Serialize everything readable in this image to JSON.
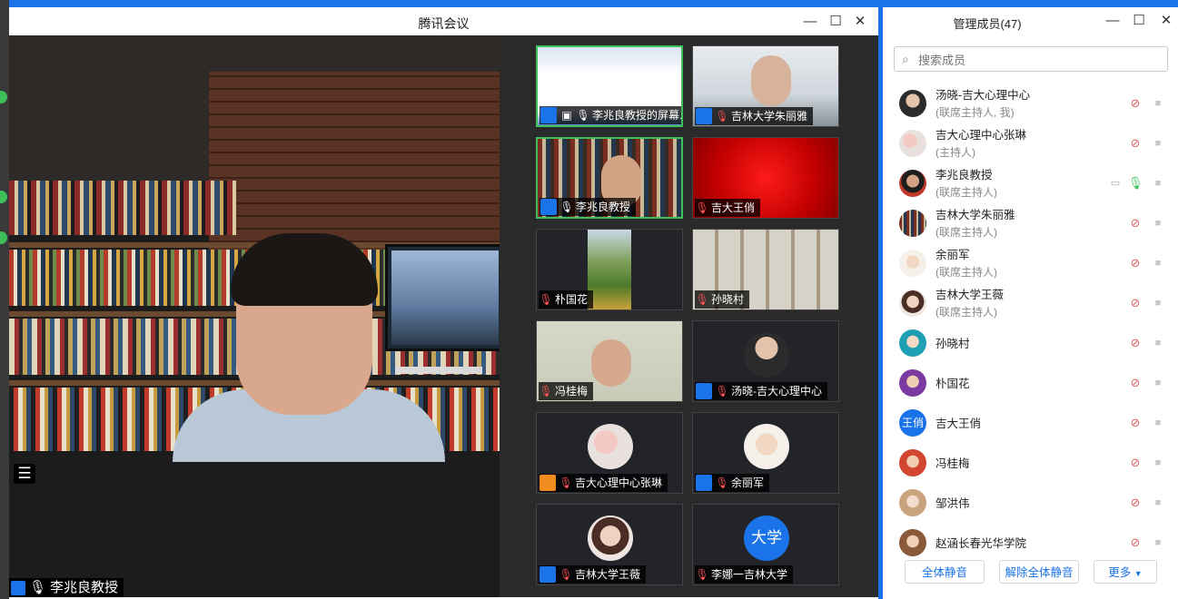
{
  "meeting_window": {
    "title": "腾讯会议",
    "speaker_name": "李兆良教授",
    "tiles": [
      {
        "name": "李兆良教授的屏幕...",
        "type": "screen",
        "mic": "on",
        "active": true
      },
      {
        "name": "吉林大学朱丽雅",
        "type": "video",
        "mic": "muted",
        "active": false
      },
      {
        "name": "李兆良教授",
        "type": "video",
        "mic": "on",
        "active": true
      },
      {
        "name": "吉大王俏",
        "type": "red",
        "mic": "muted",
        "active": false
      },
      {
        "name": "朴国花",
        "type": "landscape",
        "mic": "muted",
        "active": false
      },
      {
        "name": "孙晓村",
        "type": "room",
        "mic": "muted",
        "active": false
      },
      {
        "name": "冯桂梅",
        "type": "video",
        "mic": "muted",
        "active": false
      },
      {
        "name": "汤晓-吉大心理中心",
        "type": "avatar",
        "mic": "muted",
        "active": false
      },
      {
        "name": "吉大心理中心张琳",
        "type": "avatar",
        "mic": "muted",
        "active": false
      },
      {
        "name": "余丽军",
        "type": "avatar",
        "mic": "muted",
        "active": false
      },
      {
        "name": "吉林大学王薇",
        "type": "avatar",
        "mic": "muted",
        "active": false
      },
      {
        "name": "李娜一吉林大学",
        "type": "text-avatar",
        "avatar_text": "大学",
        "mic": "muted",
        "active": false
      }
    ]
  },
  "member_panel": {
    "title": "管理成员(47)",
    "search_placeholder": "搜索成员",
    "members": [
      {
        "name": "汤晓-吉大心理中心",
        "role": "(联席主持人, 我)",
        "mic": "muted"
      },
      {
        "name": "吉大心理中心张琳",
        "role": "(主持人)",
        "mic": "muted"
      },
      {
        "name": "李兆良教授",
        "role": "(联席主持人)",
        "mic": "on",
        "sharing": true
      },
      {
        "name": "吉林大学朱丽雅",
        "role": "(联席主持人)",
        "mic": "muted"
      },
      {
        "name": "余丽军",
        "role": "(联席主持人)",
        "mic": "muted"
      },
      {
        "name": "吉林大学王薇",
        "role": "(联席主持人)",
        "mic": "muted"
      },
      {
        "name": "孙晓村",
        "role": "",
        "mic": "muted"
      },
      {
        "name": "朴国花",
        "role": "",
        "mic": "muted"
      },
      {
        "name": "吉大王俏",
        "role": "",
        "mic": "muted",
        "avatar_text": "王俏"
      },
      {
        "name": "冯桂梅",
        "role": "",
        "mic": "muted"
      },
      {
        "name": "邹洪伟",
        "role": "",
        "mic": "muted"
      },
      {
        "name": "赵涵长春光华学院",
        "role": "",
        "mic": "muted"
      }
    ],
    "footer": {
      "mute_all": "全体静音",
      "unmute_all": "解除全体静音",
      "more": "更多"
    }
  },
  "colors": {
    "accent": "#1a73e8",
    "active_border": "#3dbf5a",
    "muted_red": "#e06060"
  }
}
